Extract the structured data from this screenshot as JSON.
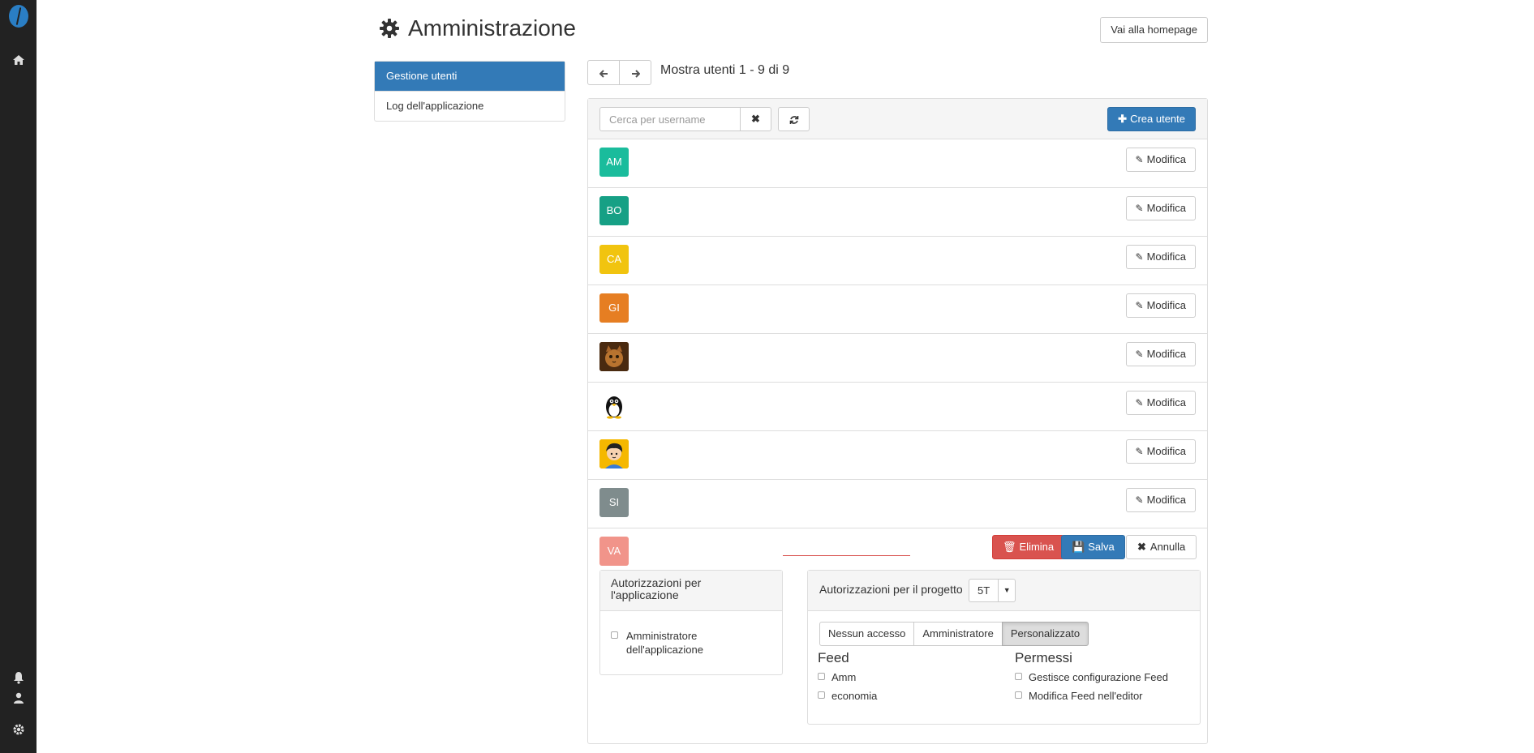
{
  "page": {
    "title": "Amministrazione",
    "home_button": "Vai alla homepage"
  },
  "sidebar": {
    "items": [
      {
        "label": "Gestione utenti",
        "active": true
      },
      {
        "label": "Log dell'applicazione",
        "active": false
      }
    ]
  },
  "pager": {
    "count_text": "Mostra utenti 1 - 9 di 9"
  },
  "toolbar": {
    "search_placeholder": "Cerca per username",
    "create_label": "Crea utente"
  },
  "users": [
    {
      "initials": "AM",
      "color": "#1abc9c",
      "edit_label": "Modifica"
    },
    {
      "initials": "BO",
      "color": "#16a085",
      "edit_label": "Modifica"
    },
    {
      "initials": "CA",
      "color": "#f1c40f",
      "edit_label": "Modifica"
    },
    {
      "initials": "GI",
      "color": "#e67e22",
      "edit_label": "Modifica"
    },
    {
      "initials": "",
      "avatar": "cat-photo",
      "edit_label": "Modifica"
    },
    {
      "initials": "",
      "avatar": "penguin-image",
      "edit_label": "Modifica"
    },
    {
      "initials": "",
      "avatar": "cartoon-boy-image",
      "edit_label": "Modifica"
    },
    {
      "initials": "SI",
      "color": "#7f8c8d",
      "edit_label": "Modifica"
    }
  ],
  "editing_user": {
    "initials": "VA",
    "color": "#f1948a",
    "delete_label": "Elimina",
    "save_label": "Salva",
    "cancel_label": "Annulla",
    "app_permissions": {
      "title": "Autorizzazioni per l'applicazione",
      "option": "Amministratore dell'applicazione"
    },
    "project_permissions": {
      "title": "Autorizzazioni per il progetto",
      "project": "5T",
      "modes": [
        "Nessun accesso",
        "Amministratore",
        "Personalizzato"
      ],
      "selected_mode": "Personalizzato",
      "feed_title": "Feed",
      "feeds": [
        "Amm",
        "economia"
      ],
      "perm_title": "Permessi",
      "perms": [
        "Gestisce configurazione Feed",
        "Modifica Feed nell'editor"
      ]
    }
  },
  "colors": {
    "primary": "#337ab7",
    "danger": "#d9534f",
    "rail": "#222222"
  }
}
